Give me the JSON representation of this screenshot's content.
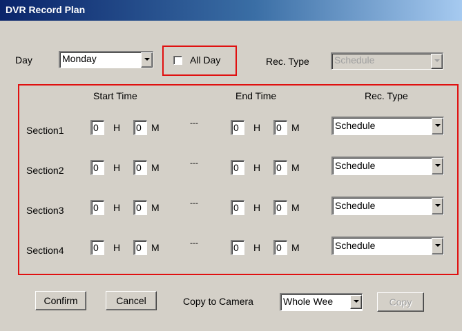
{
  "window": {
    "title": "DVR Record Plan"
  },
  "top": {
    "day_label": "Day",
    "day_value": "Monday",
    "all_day_label": "All Day",
    "all_day_checked": false,
    "rec_type_label": "Rec. Type",
    "rec_type_value": "Schedule"
  },
  "headers": {
    "start": "Start Time",
    "end": "End Time",
    "rec_type": "Rec. Type"
  },
  "units": {
    "h": "H",
    "m": "M",
    "sep": "---"
  },
  "sections": [
    {
      "label": "Section1",
      "start_h": "0",
      "start_m": "0",
      "end_h": "0",
      "end_m": "0",
      "rec_type": "Schedule"
    },
    {
      "label": "Section2",
      "start_h": "0",
      "start_m": "0",
      "end_h": "0",
      "end_m": "0",
      "rec_type": "Schedule"
    },
    {
      "label": "Section3",
      "start_h": "0",
      "start_m": "0",
      "end_h": "0",
      "end_m": "0",
      "rec_type": "Schedule"
    },
    {
      "label": "Section4",
      "start_h": "0",
      "start_m": "0",
      "end_h": "0",
      "end_m": "0",
      "rec_type": "Schedule"
    }
  ],
  "bottom": {
    "confirm_label": "Confirm",
    "cancel_label": "Cancel",
    "copy_to_camera_label": "Copy to Camera",
    "copy_target_value": "Whole Wee",
    "copy_label": "Copy"
  },
  "colors": {
    "highlight": "#e01010",
    "dialog_bg": "#d4d0c8",
    "title_bar": "#0a246a"
  }
}
